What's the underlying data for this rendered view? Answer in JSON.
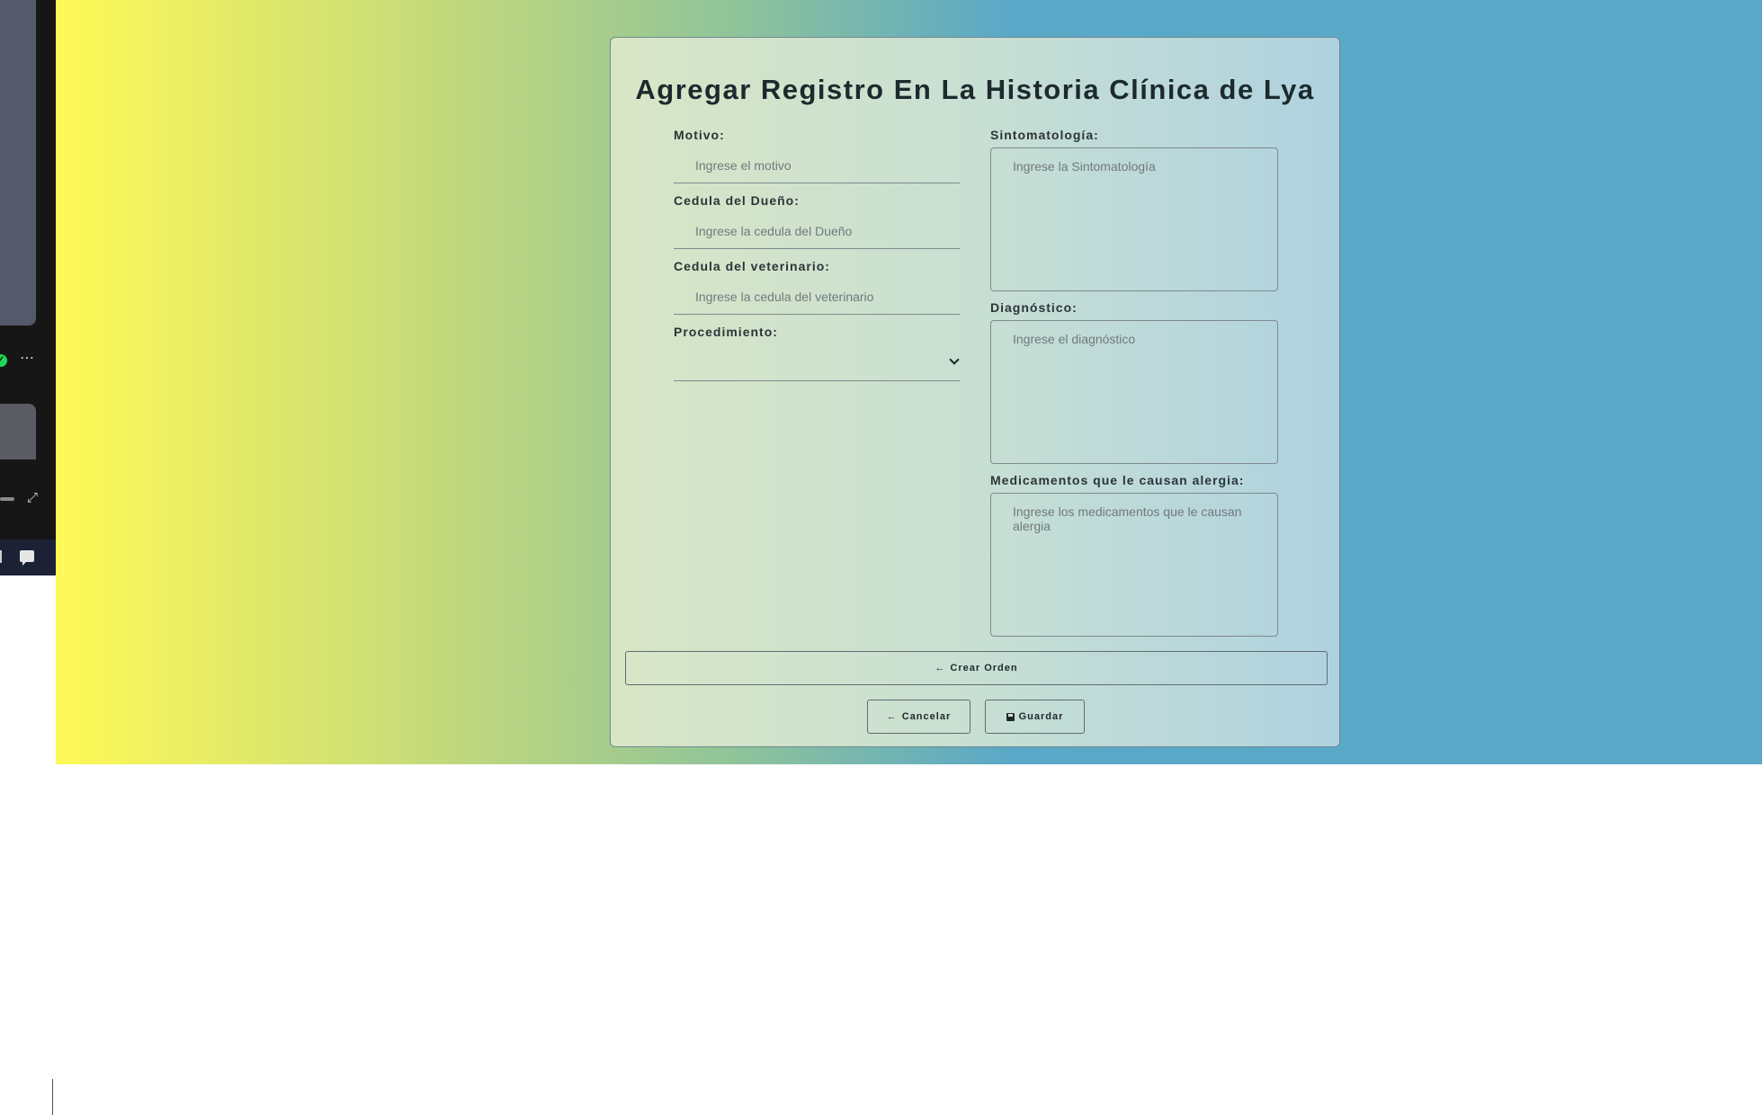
{
  "form": {
    "title": "Agregar Registro En La Historia Clínica de Lya",
    "motivo": {
      "label": "Motivo:",
      "placeholder": "Ingrese el motivo",
      "value": ""
    },
    "cedula_dueno": {
      "label": "Cedula del Dueño:",
      "placeholder": "Ingrese la cedula del Dueño",
      "value": ""
    },
    "cedula_veterinario": {
      "label": "Cedula del veterinario:",
      "placeholder": "Ingrese la cedula del veterinario",
      "value": ""
    },
    "procedimiento": {
      "label": "Procedimiento:",
      "selected": ""
    },
    "sintomatologia": {
      "label": "Sintomatología:",
      "placeholder": "Ingrese la Sintomatología"
    },
    "diagnostico": {
      "label": "Diagnóstico:",
      "placeholder": "Ingrese el diagnóstico"
    },
    "medicamentos": {
      "label": "Medicamentos que le causan alergia:",
      "placeholder": "Ingrese los medicamentos que le causan alergia"
    }
  },
  "buttons": {
    "crear_orden": "Crear Orden",
    "cancelar": "Cancelar",
    "guardar": "Guardar"
  },
  "icons": {
    "crear_orden": "arrow-left-icon",
    "cancelar": "arrow-left-icon",
    "guardar": "floppy-disk-icon"
  },
  "colors": {
    "gradient_start": "#fff957",
    "gradient_end": "#5aa8c8",
    "text": "#1c2a2e",
    "status_check": "#1fd655"
  }
}
